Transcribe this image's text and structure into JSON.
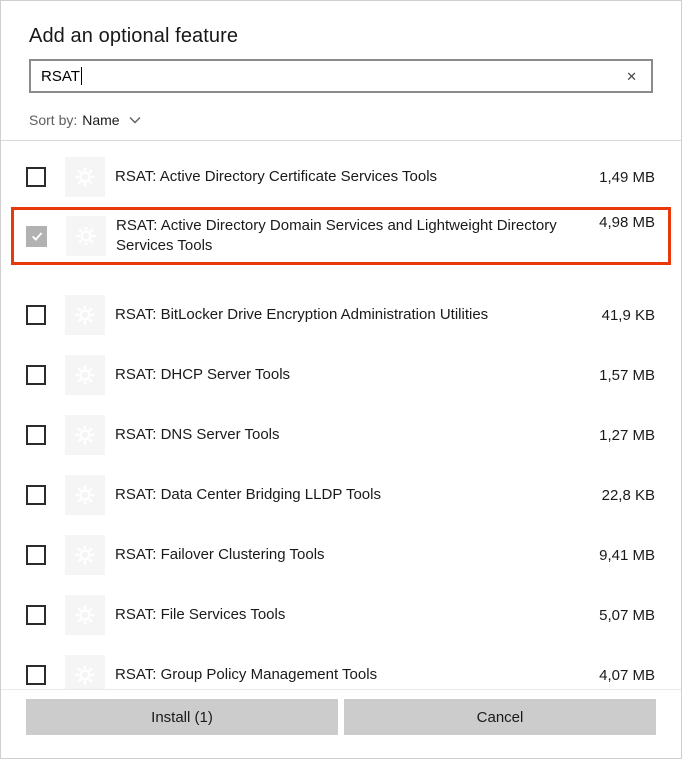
{
  "header": {
    "title": "Add an optional feature",
    "search": {
      "value": "RSAT",
      "clear_icon": "✕"
    },
    "sort": {
      "label": "Sort by:",
      "value": "Name"
    }
  },
  "features": [
    {
      "name": "RSAT: Active Directory Certificate Services Tools",
      "size": "1,49 MB",
      "checked": false,
      "highlighted": false
    },
    {
      "name": "RSAT: Active Directory Domain Services and Lightweight Directory Services Tools",
      "size": "4,98 MB",
      "checked": true,
      "highlighted": true
    },
    {
      "name": "RSAT: BitLocker Drive Encryption Administration Utilities",
      "size": "41,9 KB",
      "checked": false,
      "highlighted": false
    },
    {
      "name": "RSAT: DHCP Server Tools",
      "size": "1,57 MB",
      "checked": false,
      "highlighted": false
    },
    {
      "name": "RSAT: DNS Server Tools",
      "size": "1,27 MB",
      "checked": false,
      "highlighted": false
    },
    {
      "name": "RSAT: Data Center Bridging LLDP Tools",
      "size": "22,8 KB",
      "checked": false,
      "highlighted": false
    },
    {
      "name": "RSAT: Failover Clustering Tools",
      "size": "9,41 MB",
      "checked": false,
      "highlighted": false
    },
    {
      "name": "RSAT: File Services Tools",
      "size": "5,07 MB",
      "checked": false,
      "highlighted": false
    },
    {
      "name": "RSAT: Group Policy Management Tools",
      "size": "4,07 MB",
      "checked": false,
      "highlighted": false
    }
  ],
  "footer": {
    "install_label": "Install (1)",
    "cancel_label": "Cancel"
  },
  "colors": {
    "highlight_border": "#e8380c",
    "button_bg": "#cccccc",
    "checked_checkbox_bg": "#b2b2b2",
    "icon_tile_bg": "#f5f5f5",
    "search_border": "#8c8c8c"
  }
}
